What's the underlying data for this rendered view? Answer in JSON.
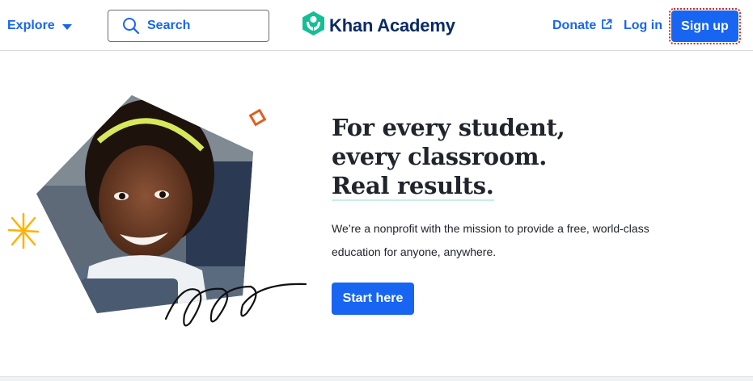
{
  "header": {
    "explore_label": "Explore",
    "search_label": "Search",
    "logo_text": "Khan Academy",
    "donate_label": "Donate",
    "login_label": "Log in",
    "signup_label": "Sign up"
  },
  "hero": {
    "headline_line1": "For every student,",
    "headline_line2": "every classroom.",
    "headline_line3": "Real results.",
    "description_line1": "We’re a nonprofit with the mission to provide a free, world-class",
    "description_line2": "education for anyone, anywhere.",
    "cta_label": "Start here"
  },
  "icons": {
    "explore_caret": "chevron-down-icon",
    "search": "search-icon",
    "logo": "khan-academy-logo-icon",
    "donate_external": "external-link-icon"
  },
  "colors": {
    "brand_blue": "#1865f2",
    "logo_green": "#14bf96",
    "logo_navy": "#0a2a66",
    "focus_outline": "#d92916",
    "accent_orange": "#e35c1f",
    "accent_yellow": "#ffb100"
  }
}
